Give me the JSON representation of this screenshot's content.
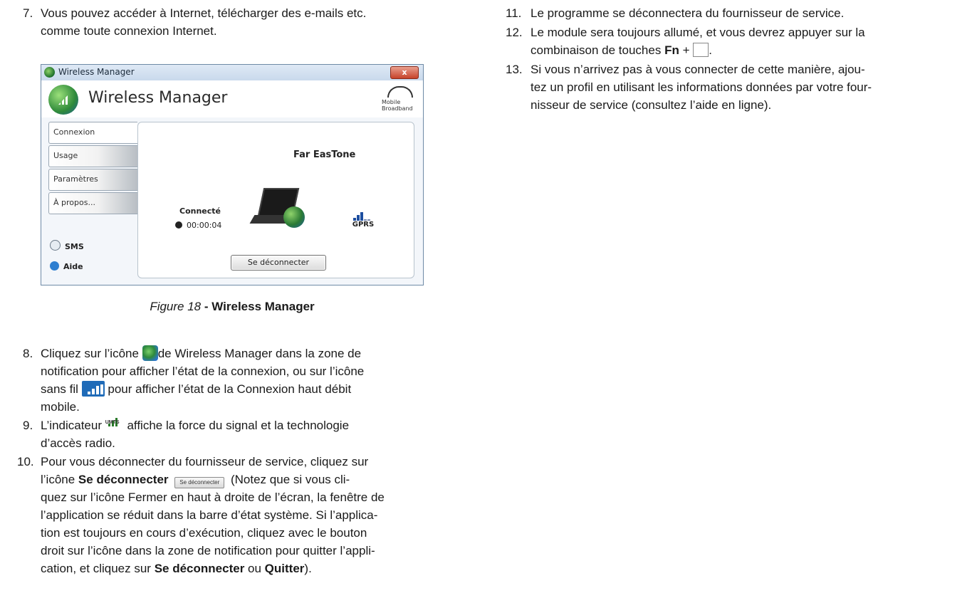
{
  "left": {
    "item7": {
      "number": "7.",
      "line1": "Vous pouvez accéder à Internet, télécharger des e-mails etc.",
      "line2": "comme toute connexion Internet."
    },
    "screenshot": {
      "window_title": "Wireless Manager",
      "close_glyph": "x",
      "app_name": "Wireless Manager",
      "brand_line1": "Mobile",
      "brand_line2": "Broadband",
      "tabs": [
        "Connexion",
        "Usage",
        "Paramètres",
        "À propos..."
      ],
      "sms_label": "SMS",
      "help_label": "Aide",
      "carrier": "Far EasTone",
      "status": "Connecté",
      "timer": "00:00:04",
      "network_type": "GPRS",
      "disconnect_button": "Se déconnecter"
    },
    "caption": {
      "figure": "Figure 18",
      "title": " - Wireless Manager"
    },
    "item8": {
      "number": "8.",
      "a": "Cliquez sur l’icône ",
      "b": "de Wireless Manager dans la zone de",
      "line2": "notification pour afficher l’état de la connexion, ou sur l’icône",
      "c": "sans fil ",
      "d": " pour afficher l’état de la Connexion haut débit",
      "line4": "mobile."
    },
    "item9": {
      "number": "9.",
      "a": "L’indicateur ",
      "umts": "UMTS",
      "b": " affiche la force du signal et la technologie",
      "line2": "d’accès radio."
    },
    "item10": {
      "number": "10.",
      "line1": "Pour vous déconnecter du fournisseur de service, cliquez sur",
      "a": "l’icône ",
      "bold1": "Se déconnecter",
      "btn": "Se déconnecter",
      "b": " (Notez que si vous cli-",
      "line3": "quez sur l’icône Fermer en haut à droite de l’écran, la fenêtre de",
      "line4": "l’application se réduit dans la barre d’état système. Si l’applica-",
      "line5": "tion est toujours en cours d’exécution, cliquez avec le bouton",
      "line6": "droit sur l’icône dans la zone de notification pour quitter l’appli-",
      "c": "cation, et cliquez sur ",
      "bold2": "Se déconnecter",
      "d": " ou ",
      "bold3": "Quitter",
      "e": ")."
    }
  },
  "right": {
    "item11": {
      "number": "11.",
      "text": "Le programme se déconnectera du fournisseur de service."
    },
    "item12": {
      "number": "12.",
      "line1": "Le module sera toujours allumé, et vous devrez appuyer sur la",
      "a": "combinaison de touches ",
      "bold": "Fn",
      "b": " + ",
      "c": "."
    },
    "item13": {
      "number": "13.",
      "line1": "Si vous n’arrivez pas à vous connecter de cette manière, ajou-",
      "line2": "tez un profil en utilisant les informations données par votre four-",
      "line3": "nisseur de service (consultez l’aide en ligne)."
    }
  }
}
